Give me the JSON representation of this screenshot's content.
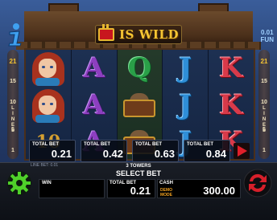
{
  "header": {
    "title": "IS WILD",
    "fun_amount": "0.01",
    "fun_currency": "FUN",
    "info_icon": "info-icon",
    "logo_icon": "crown-icon"
  },
  "paylines": {
    "left": [
      "21",
      "15",
      "10",
      "5",
      "1"
    ],
    "right": [
      "21",
      "15",
      "10",
      "5",
      "1"
    ],
    "word": "LINES"
  },
  "reels": [
    [
      "lady",
      "lady",
      "10"
    ],
    [
      "A",
      "A",
      "A"
    ],
    [
      "Q",
      "chest",
      "chest"
    ],
    [
      "J",
      "J",
      "J"
    ],
    [
      "K",
      "K",
      "K"
    ]
  ],
  "bet_options": [
    {
      "label": "TOTAL BET",
      "value": "0.21"
    },
    {
      "label": "TOTAL BET",
      "value": "0.42"
    },
    {
      "label": "TOTAL BET",
      "value": "0.63"
    },
    {
      "label": "TOTAL BET",
      "value": "0.84"
    }
  ],
  "controls": {
    "line_info": "LINE BET: 0.01",
    "towers": "3 TOWERS",
    "select_bet": "SELECT BET",
    "win_label": "WIN",
    "win_value": "",
    "total_bet_label": "TOTAL BET",
    "total_bet_value": "0.21",
    "cash_label": "CASH",
    "cash_value": "300.00",
    "demo_line1": "DEMO",
    "demo_line2": "MODE"
  },
  "colors": {
    "accent_gold": "#f4c433",
    "spin_red": "#d61f2a",
    "settings_green": "#4fd02a",
    "demo_orange": "#f0a020"
  }
}
